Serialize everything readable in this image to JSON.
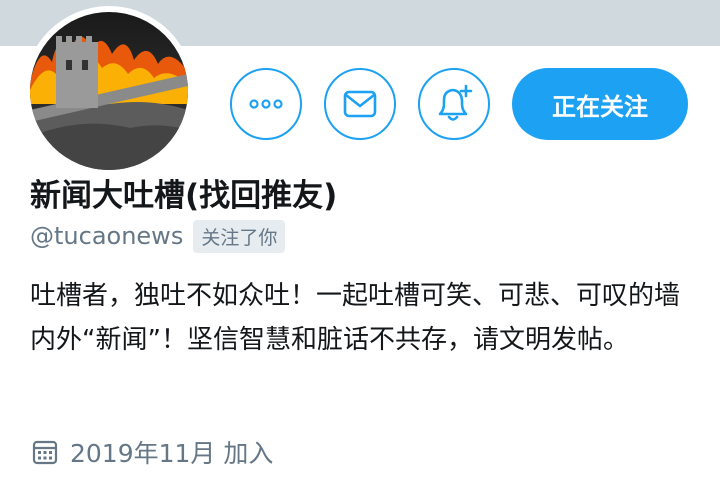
{
  "profile": {
    "display_name": "新闻大吐槽(找回推友)",
    "handle": "@tucaonews",
    "follows_you_badge": "关注了你",
    "bio": "吐槽者，独吐不如众吐！一起吐槽可笑、可悲、可叹的墙内外“新闻”！坚信智慧和脏话不共存，请文明发帖。",
    "joined": "2019年11月 加入"
  },
  "actions": {
    "more_icon": "more-horizontal-icon",
    "message_icon": "envelope-icon",
    "notify_icon": "bell-plus-icon",
    "follow_label": "正在关注"
  },
  "icons": {
    "joined": "calendar-icon"
  },
  "colors": {
    "accent": "#1da1f2",
    "banner": "#cfd9de",
    "text": "#14171a",
    "secondary": "#657786"
  }
}
